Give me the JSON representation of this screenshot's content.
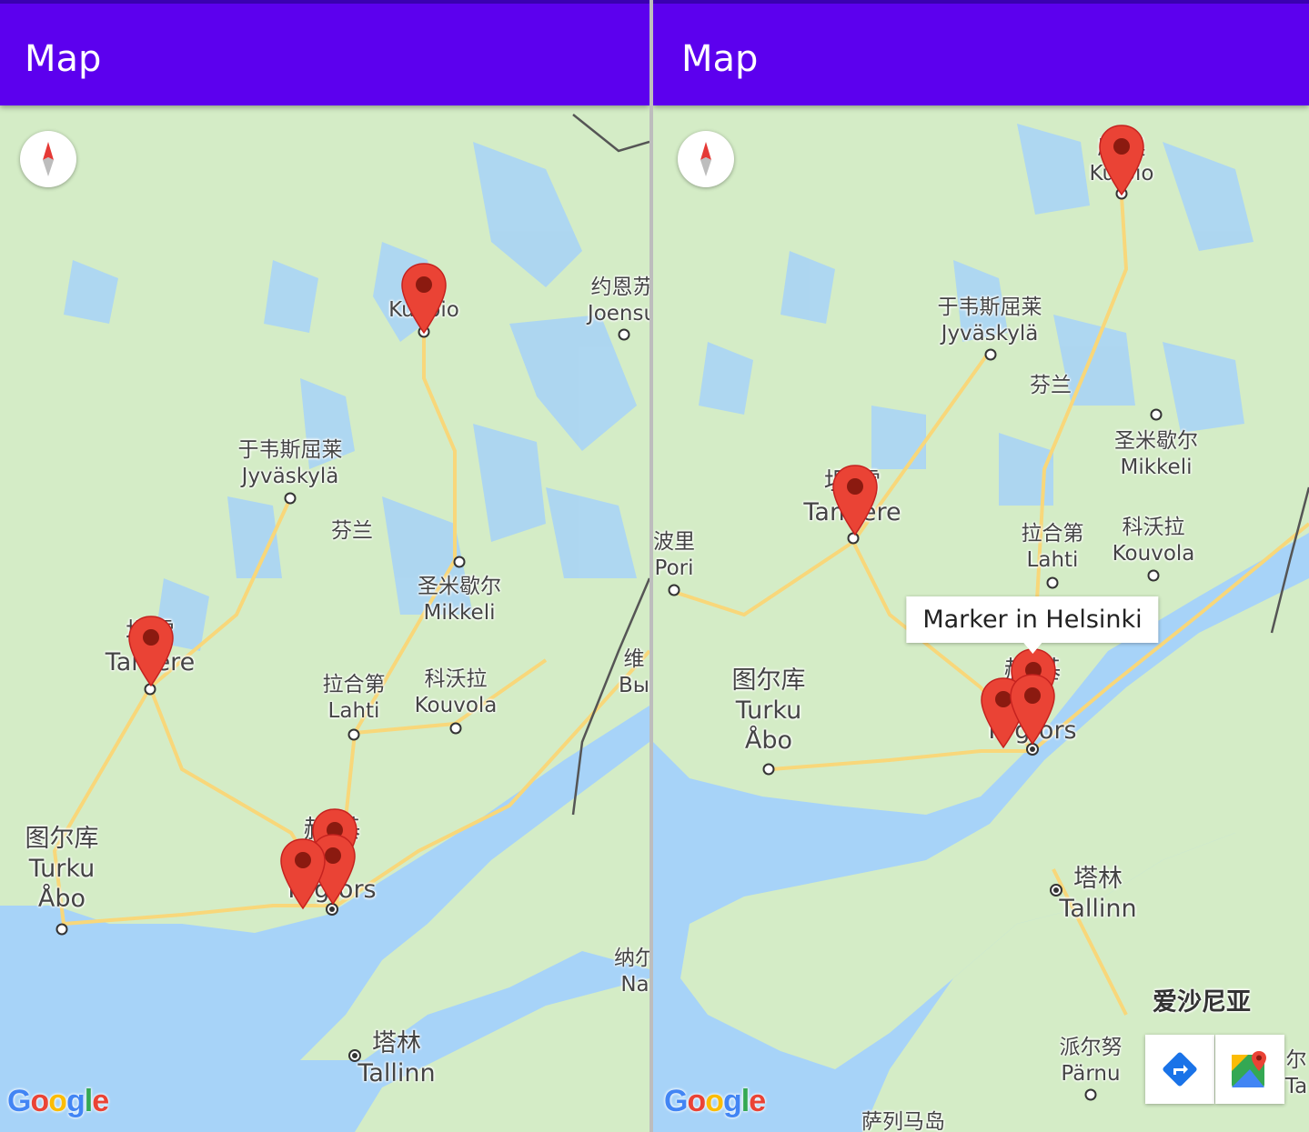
{
  "screens": [
    {
      "title": "Map",
      "labels": [
        {
          "id": "kuopio",
          "zh": "库奥",
          "en": "Kuopio"
        },
        {
          "id": "joensuu",
          "zh": "约恩苏",
          "en": "Joensu"
        },
        {
          "id": "jyvaskyla",
          "zh": "于韦斯屈莱",
          "en": "Jyväskylä"
        },
        {
          "id": "finland",
          "zh": "芬兰"
        },
        {
          "id": "mikkeli",
          "zh": "圣米歇尔",
          "en": "Mikkeli"
        },
        {
          "id": "tampere",
          "zh": "坦雷",
          "en": "Tamere"
        },
        {
          "id": "lahti",
          "zh": "拉合第",
          "en": "Lahti"
        },
        {
          "id": "kouvola",
          "zh": "科沃拉",
          "en": "Kouvola"
        },
        {
          "id": "vyborg",
          "zh": "维",
          "en": "Вы"
        },
        {
          "id": "turku",
          "zh": "图尔库",
          "en": "Turku",
          "alt": "Åbo"
        },
        {
          "id": "helsinki",
          "zh": "赫 基",
          "en": "ki",
          "alt": "H   gfors"
        },
        {
          "id": "narva",
          "zh": "纳尔",
          "en": "Na"
        },
        {
          "id": "tallinn",
          "zh": "塔林",
          "en": "Tallinn"
        }
      ],
      "google": "Google"
    },
    {
      "title": "Map",
      "labels": [
        {
          "id": "kuopio",
          "zh": "库 奥",
          "en": "Ku pio"
        },
        {
          "id": "jyvaskyla",
          "zh": "于韦斯屈莱",
          "en": "Jyväskylä"
        },
        {
          "id": "finland",
          "zh": "芬兰"
        },
        {
          "id": "mikkeli",
          "zh": "圣米歇尔",
          "en": "Mikkeli"
        },
        {
          "id": "tampere",
          "zh": "坦 雷",
          "en": "Tam ere"
        },
        {
          "id": "pori",
          "zh": "波里",
          "en": "Pori"
        },
        {
          "id": "lahti",
          "zh": "拉合第",
          "en": "Lahti"
        },
        {
          "id": "kouvola",
          "zh": "科沃拉",
          "en": "Kouvola"
        },
        {
          "id": "turku",
          "zh": "图尔库",
          "en": "Turku",
          "alt": "Åbo"
        },
        {
          "id": "helsinki",
          "zh": "赫  基",
          "en": "ki",
          "alt": "H   gfors"
        },
        {
          "id": "tallinn",
          "zh": "塔林",
          "en": "Tallinn"
        },
        {
          "id": "estonia",
          "zh": "爱沙尼亚"
        },
        {
          "id": "parnu",
          "zh": "派尔努",
          "en": "Pärnu"
        },
        {
          "id": "tartu",
          "zh": "尔",
          "en": "Ta"
        },
        {
          "id": "saaremaa",
          "zh": "萨列马岛"
        }
      ],
      "info_window": "Marker in Helsinki",
      "google": "Google"
    }
  ],
  "colors": {
    "appbar": "#5c00ee",
    "land": "#d4ecc6",
    "water": "#a7d3f8",
    "road": "#f8d77a",
    "marker": "#ea4335"
  }
}
